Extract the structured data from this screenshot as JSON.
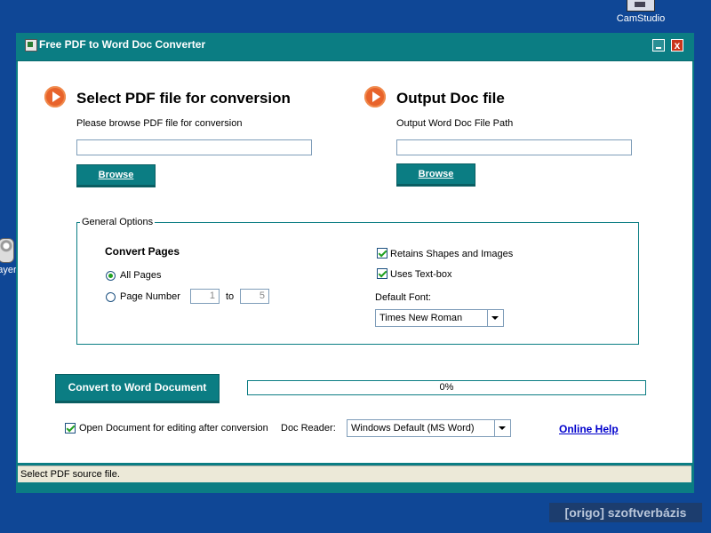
{
  "desktop": {
    "icons": [
      {
        "label": "CamStudio"
      },
      {
        "label": "ayer"
      }
    ]
  },
  "window": {
    "title": "Free PDF to Word Doc Converter",
    "close_glyph": "x"
  },
  "input_section": {
    "title": "Select PDF file for conversion",
    "hint": "Please browse PDF file for conversion",
    "path_value": "",
    "browse_label": "Browse"
  },
  "output_section": {
    "title": "Output Doc file",
    "hint": "Output Word Doc File Path",
    "path_value": "",
    "browse_label": "Browse"
  },
  "options": {
    "legend": "General Options",
    "convert_pages_heading": "Convert Pages",
    "all_pages_label": "All Pages",
    "all_pages_selected": true,
    "page_number_label": "Page Number",
    "page_from": "1",
    "to_label": "to",
    "page_to": "5",
    "retain_shapes_label": "Retains Shapes and Images",
    "retain_shapes_checked": true,
    "text_box_label": "Uses Text-box",
    "text_box_checked": true,
    "default_font_label": "Default Font:",
    "default_font_value": "Times New Roman"
  },
  "actions": {
    "convert_label": "Convert to Word Document",
    "progress_text": "0%",
    "progress_value": 0,
    "open_after_label": "Open Document for editing after conversion",
    "open_after_checked": true,
    "doc_reader_label": "Doc Reader:",
    "doc_reader_value": "Windows Default (MS Word)",
    "online_help_label": "Online Help"
  },
  "status_bar": {
    "text": "Select PDF source file."
  },
  "watermark": {
    "text": "[origo] szoftverbázis"
  },
  "colors": {
    "desktop": "#0f4796",
    "accent_teal": "#0b7d83",
    "arrow_orange": "#e8632b",
    "link_blue": "#0000cc"
  }
}
